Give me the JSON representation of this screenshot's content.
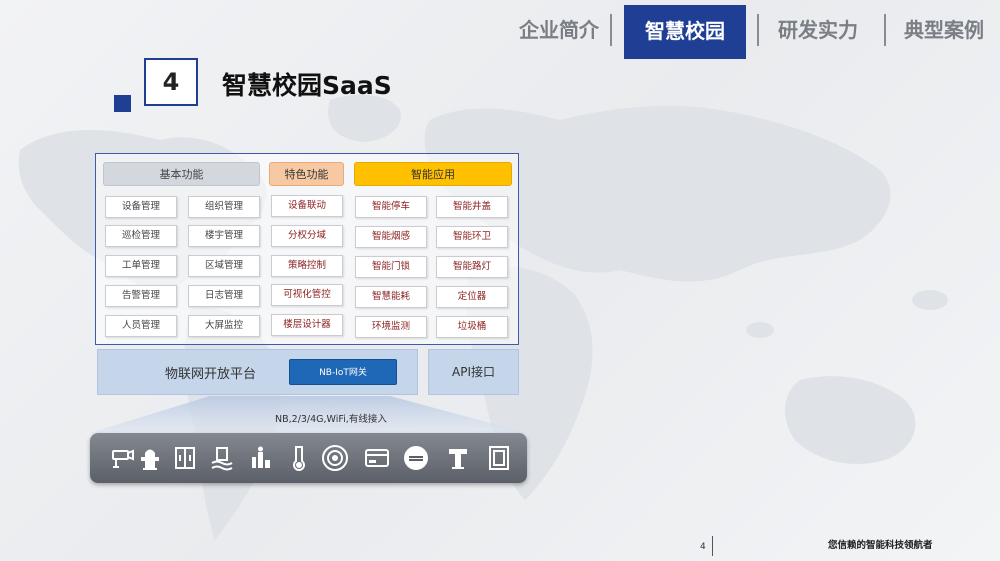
{
  "nav": {
    "tabs": [
      {
        "label": "企业简介",
        "active": false
      },
      {
        "label": "智慧校园",
        "active": true
      },
      {
        "label": "研发实力",
        "active": false
      },
      {
        "label": "典型案例",
        "active": false
      }
    ]
  },
  "section": {
    "number": "4",
    "title": "智慧校园SaaS"
  },
  "categories": {
    "basic": "基本功能",
    "special": "特色功能",
    "smart": "智能应用"
  },
  "basic_features": [
    [
      "设备管理",
      "组织管理"
    ],
    [
      "巡检管理",
      "楼宇管理"
    ],
    [
      "工单管理",
      "区域管理"
    ],
    [
      "告警管理",
      "日志管理"
    ],
    [
      "人员管理",
      "大屏监控"
    ]
  ],
  "special_features": [
    "设备联动",
    "分权分域",
    "策略控制",
    "可视化管控",
    "楼层设计器"
  ],
  "smart_apps": [
    [
      "智能停车",
      "智能井盖"
    ],
    [
      "智能烟感",
      "智能环卫"
    ],
    [
      "智能门锁",
      "智能路灯"
    ],
    [
      "智慧能耗",
      "定位器"
    ],
    [
      "环境监测",
      "垃圾桶"
    ]
  ],
  "platform": {
    "label": "物联网开放平台",
    "gateway_button": "NB-IoT网关",
    "api": "API接口"
  },
  "network_label": "NB,2/3/4G,WiFi,有线接入",
  "devices": [
    "camera-icon",
    "fire-hydrant-icon",
    "door-access-icon",
    "water-level-icon",
    "lab-sensor-icon",
    "thermometer-icon",
    "smoke-detector-icon",
    "card-reader-icon",
    "street-lamp-icon",
    "manhole-icon",
    "door-lock-icon"
  ],
  "colors": {
    "brand": "#1e3f93",
    "accent_orange": "#f6c9a3",
    "accent_yellow": "#ffc000",
    "gateway_blue": "#1f68b8",
    "red_text": "#8b1f1f"
  },
  "footer": {
    "page": "4",
    "slogan": "您信赖的智能科技领航者"
  }
}
